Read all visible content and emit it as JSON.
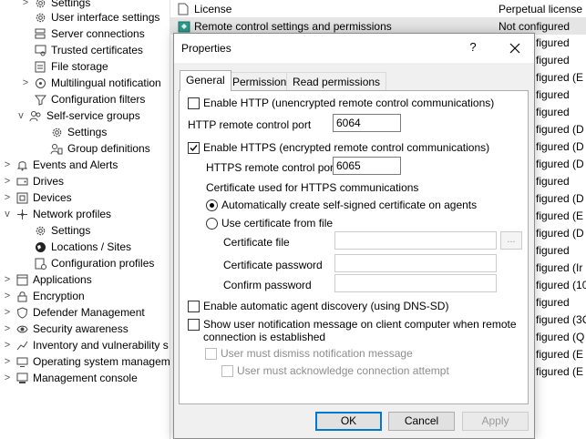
{
  "tree": {
    "items": [
      {
        "label": "Settings",
        "icon": "gear-icon",
        "expander": ">"
      },
      {
        "label": "User interface settings",
        "icon": "gear-icon",
        "expander": ""
      },
      {
        "label": "Server connections",
        "icon": "server-icon",
        "expander": ""
      },
      {
        "label": "Trusted certificates",
        "icon": "certificate-icon",
        "expander": ""
      },
      {
        "label": "File storage",
        "icon": "file-storage-icon",
        "expander": ""
      },
      {
        "label": "Multilingual notification",
        "icon": "multilingual-icon",
        "expander": ">"
      },
      {
        "label": "Configuration filters",
        "icon": "filter-icon",
        "expander": ""
      },
      {
        "label": "Self-service groups",
        "icon": "group-icon",
        "expander": "v"
      },
      {
        "label": "Settings",
        "icon": "gear-icon",
        "expander": ""
      },
      {
        "label": "Group definitions",
        "icon": "group-definitions-icon",
        "expander": ""
      },
      {
        "label": "Events and Alerts",
        "icon": "bell-icon",
        "expander": ">"
      },
      {
        "label": "Drives",
        "icon": "drive-icon",
        "expander": ">"
      },
      {
        "label": "Devices",
        "icon": "device-icon",
        "expander": ">"
      },
      {
        "label": "Network profiles",
        "icon": "network-icon",
        "expander": "v"
      },
      {
        "label": "Settings",
        "icon": "gear-icon",
        "expander": ""
      },
      {
        "label": "Locations / Sites",
        "icon": "globe-icon",
        "expander": ""
      },
      {
        "label": "Configuration profiles",
        "icon": "config-profile-icon",
        "expander": ""
      },
      {
        "label": "Applications",
        "icon": "applications-icon",
        "expander": ">"
      },
      {
        "label": "Encryption",
        "icon": "lock-icon",
        "expander": ">"
      },
      {
        "label": "Defender Management",
        "icon": "shield-icon",
        "expander": ">"
      },
      {
        "label": "Security awareness",
        "icon": "security-awareness-icon",
        "expander": ">"
      },
      {
        "label": "Inventory and vulnerability s",
        "icon": "inventory-icon",
        "expander": ">"
      },
      {
        "label": "Operating system managem",
        "icon": "os-icon",
        "expander": ">"
      },
      {
        "label": "Management console",
        "icon": "console-icon",
        "expander": ">"
      }
    ]
  },
  "list": {
    "rows": [
      {
        "name": "License",
        "value": "Perpetual license"
      },
      {
        "name": "Remote control settings and permissions",
        "value": "Not configured"
      }
    ],
    "obscured_values": [
      "figured",
      "figured",
      "figured (E",
      "figured",
      "figured",
      "figured (D",
      "figured (D",
      "figured (D",
      "figured",
      "figured (D",
      "figured (E",
      "figured (D",
      "figured",
      "figured (Ir",
      "figured (10",
      "figured",
      "figured (3C",
      "figured (Q",
      "figured (E",
      "figured (E"
    ]
  },
  "dialog": {
    "title": "Properties",
    "help": "?",
    "tabs": [
      "General",
      "Permissions",
      "Read permissions"
    ],
    "enable_http": {
      "label": "Enable HTTP (unencrypted remote control communications)",
      "checked": false
    },
    "http_port_label": "HTTP remote control port",
    "http_port_value": "6064",
    "enable_https": {
      "label": "Enable HTTPS (encrypted remote control communications)",
      "checked": true
    },
    "https_port_label": "HTTPS remote control port",
    "https_port_value": "6065",
    "cert_section_label": "Certificate used for HTTPS communications",
    "radio_auto": {
      "label": "Automatically create self-signed certificate on agents",
      "selected": true
    },
    "radio_file": {
      "label": "Use certificate from file",
      "selected": false
    },
    "cert_file_label": "Certificate file",
    "cert_file_value": "",
    "browse_label": "...",
    "cert_password_label": "Certificate password",
    "cert_password_value": "",
    "confirm_password_label": "Confirm password",
    "confirm_password_value": "",
    "agent_discovery": {
      "label": "Enable automatic agent discovery (using DNS-SD)",
      "checked": false
    },
    "show_notification": {
      "label_line1": "Show user notification message on client computer when remote",
      "label_line2": "connection is established",
      "checked": false
    },
    "must_dismiss": {
      "label": "User must dismiss notification message",
      "checked": false
    },
    "must_acknowledge": {
      "label": "User must acknowledge connection attempt",
      "checked": false
    },
    "buttons": {
      "ok": "OK",
      "cancel": "Cancel",
      "apply": "Apply"
    }
  },
  "colors": {
    "accent": "#0078d7",
    "selection": "#e5e5e5",
    "dialog_bg": "#f0f0f0",
    "disabled_text": "#8d8d8d"
  }
}
